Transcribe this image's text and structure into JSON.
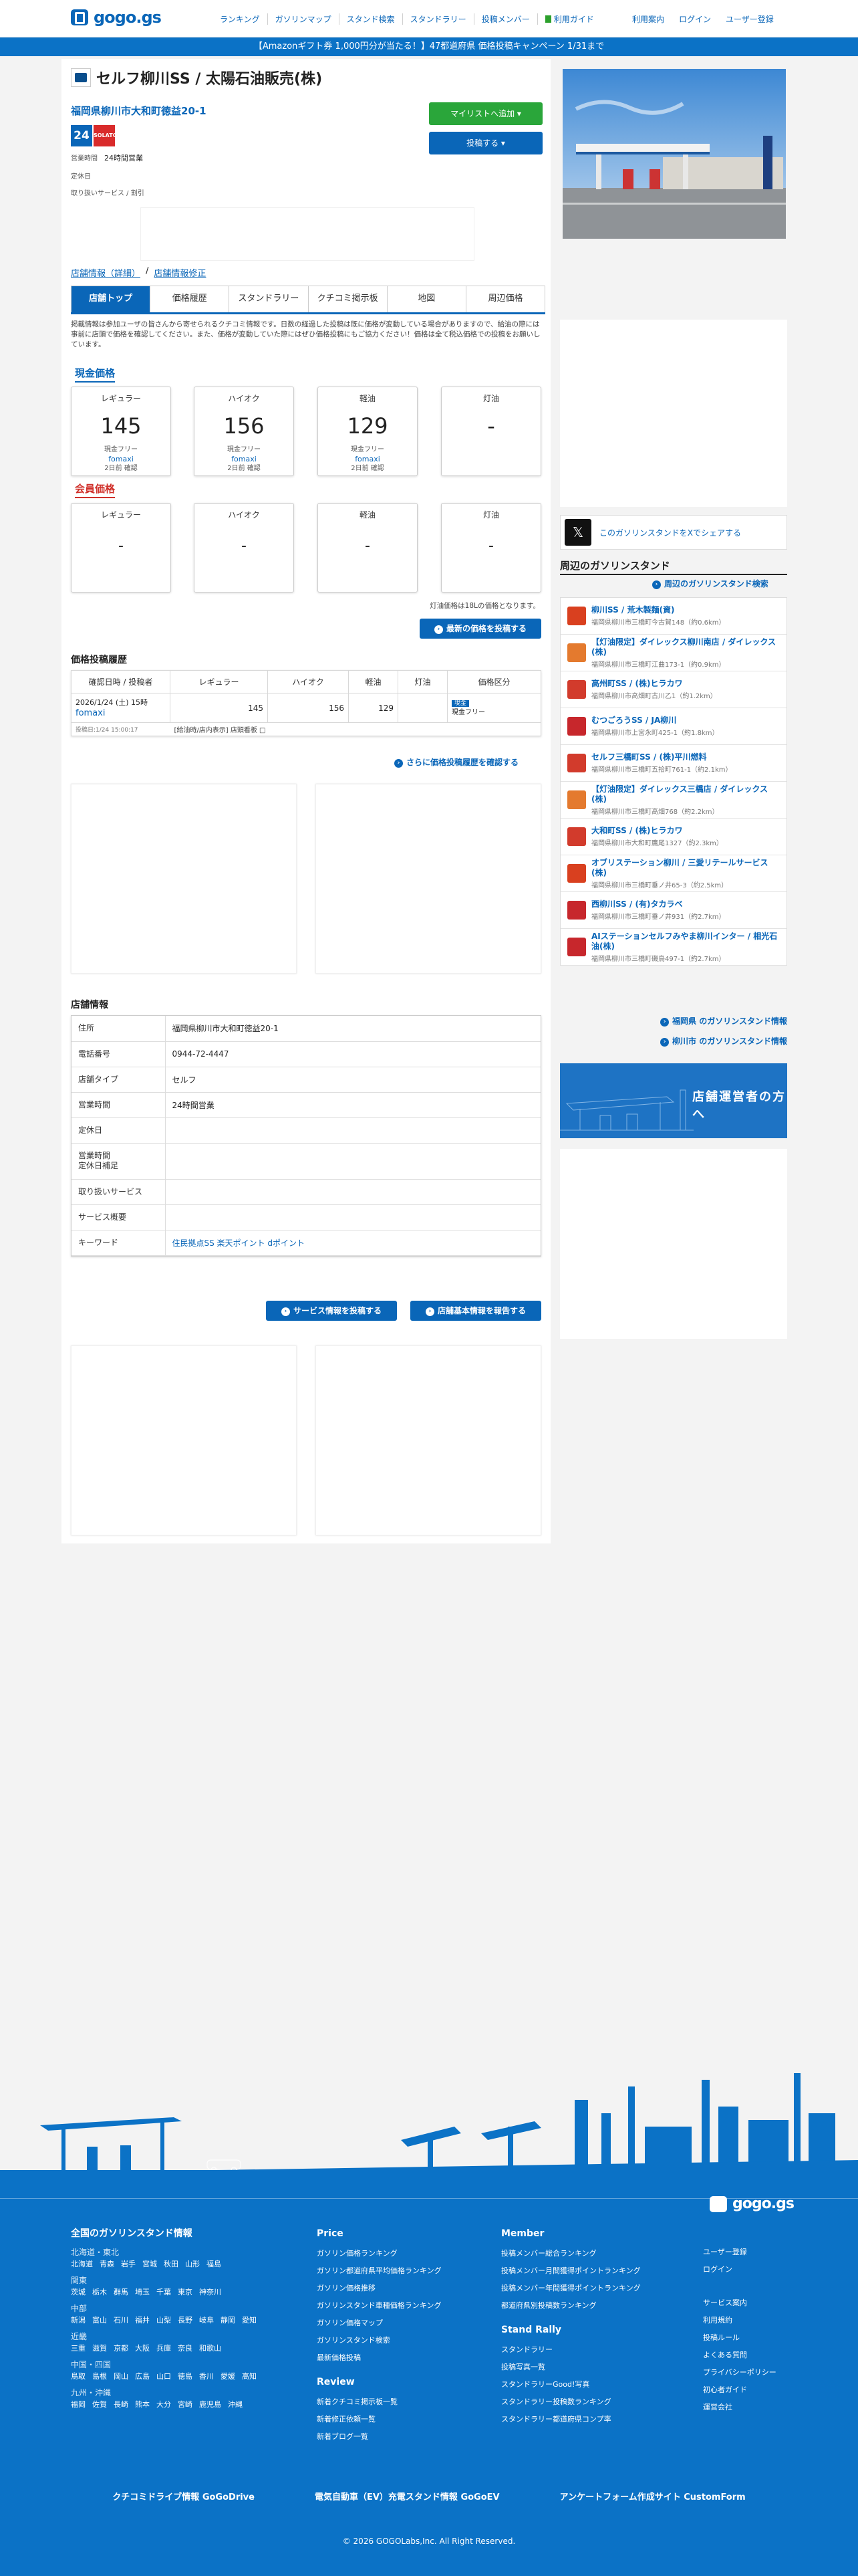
{
  "header": {
    "logo": "gogo.gs",
    "nav": [
      "ランキング",
      "ガソリンマップ",
      "スタンド検索",
      "スタンドラリー",
      "投稿メンバー",
      "利用ガイド"
    ],
    "right": [
      "利用案内",
      "ログイン",
      "ユーザー登録"
    ]
  },
  "banner": "【Amazonギフト券 1,000円分が当たる！】47都道府県 価格投稿キャンペーン 1/31まで",
  "station": {
    "name": "セルフ柳川SS / 太陽石油販売(株)",
    "address": "福岡県柳川市大和町徳益20-1",
    "badge24": "24",
    "brand": "SOLATO",
    "hours_label": "営業時間",
    "hours": "24時間営業",
    "closed_label": "定休日",
    "services_label": "取り扱いサービス / 割引",
    "mylist": "マイリストへ追加",
    "post": "投稿する"
  },
  "breadcrumb": [
    "店舗情報（詳細）",
    "店舗情報修正"
  ],
  "tabs": [
    "店舗トップ",
    "価格履歴",
    "スタンドラリー",
    "クチコミ掲示板",
    "地図",
    "周辺価格"
  ],
  "notice": "掲載情報は参加ユーザの皆さんから寄せられるクチコミ情報です。日数の経過した投稿は既に価格が変動している場合がありますので、給油の際には事前に店頭で価格を確認してください。また、価格が変動していた際にはぜひ価格投稿にもご協力ください！価格は全て税込価格での投稿をお願いしています。",
  "cash": {
    "title": "現金価格",
    "items": [
      {
        "label": "レギュラー",
        "value": "145",
        "kind": "現金フリー",
        "user": "fomaxi",
        "ago": "2日前 確認"
      },
      {
        "label": "ハイオク",
        "value": "156",
        "kind": "現金フリー",
        "user": "fomaxi",
        "ago": "2日前 確認"
      },
      {
        "label": "軽油",
        "value": "129",
        "kind": "現金フリー",
        "user": "fomaxi",
        "ago": "2日前 確認"
      },
      {
        "label": "灯油",
        "value": "-",
        "kind": "",
        "user": "",
        "ago": ""
      }
    ]
  },
  "member": {
    "title": "会員価格",
    "items": [
      {
        "label": "レギュラー",
        "value": "-"
      },
      {
        "label": "ハイオク",
        "value": "-"
      },
      {
        "label": "軽油",
        "value": "-"
      },
      {
        "label": "灯油",
        "value": "-"
      }
    ]
  },
  "kerosene_note": "灯油価格は18Lの価格となります。",
  "post_latest": "最新の価格を投稿する",
  "history": {
    "title": "価格投稿履歴",
    "headers": [
      "確認日時 / 投稿者",
      "レギュラー",
      "ハイオク",
      "軽油",
      "灯油",
      "価格区分"
    ],
    "row": {
      "date": "2026/1/24 (土) 15時",
      "user": "fomaxi",
      "regular": "145",
      "high": "156",
      "diesel": "129",
      "kerosene": "",
      "kind_badge": "現金",
      "kind": "現金フリー",
      "posted": "投稿日:1/24 15:00:17",
      "note": "[給油時/店内表示] 店頭看板 □"
    }
  },
  "more_history": "さらに価格投稿履歴を確認する",
  "info": {
    "title": "店舗情報",
    "rows": [
      {
        "k": "住所",
        "v": "福岡県柳川市大和町徳益20-1"
      },
      {
        "k": "電話番号",
        "v": "0944-72-4447"
      },
      {
        "k": "店舗タイプ",
        "v": "セルフ"
      },
      {
        "k": "営業時間",
        "v": "24時間営業"
      },
      {
        "k": "定休日",
        "v": ""
      },
      {
        "k": "営業時間\n定休日補足",
        "v": ""
      },
      {
        "k": "取り扱いサービス",
        "v": ""
      },
      {
        "k": "サービス概要",
        "v": ""
      },
      {
        "k": "キーワード",
        "v": "住民拠点SS 楽天ポイント dポイント"
      }
    ]
  },
  "btn_service": "サービス情報を投稿する",
  "btn_report": "店舗基本情報を報告する",
  "share_x": "このガソリンスタンドをXでシェアする",
  "nearby": {
    "title": "周辺のガソリンスタンド",
    "search": "周辺のガソリンスタンド検索",
    "items": [
      {
        "name": "柳川SS / 荒木製麺(資)",
        "addr": "福岡県柳川市三橋町今古賀148（約0.6km）",
        "c": "#d9401f"
      },
      {
        "name": "【灯油限定】ダイレックス柳川南店 / ダイレックス(株)",
        "addr": "福岡県柳川市三橋町江曲173-1（約0.9km）",
        "c": "#e47a2e"
      },
      {
        "name": "高州町SS / (株)ヒラカワ",
        "addr": "福岡県柳川市高畑町古川乙1（約1.2km）",
        "c": "#d23b2c"
      },
      {
        "name": "むつごろうSS / JA柳川",
        "addr": "福岡県柳川市上宮永町425-1（約1.8km）",
        "c": "#c7272c"
      },
      {
        "name": "セルフ三橋町SS / (株)平川燃料",
        "addr": "福岡県柳川市三橋町五拾町761-1（約2.1km）",
        "c": "#d23b2c"
      },
      {
        "name": "【灯油限定】ダイレックス三橋店 / ダイレックス(株)",
        "addr": "福岡県柳川市三橋町高畑768（約2.2km）",
        "c": "#e47a2e"
      },
      {
        "name": "大和町SS / (株)ヒラカワ",
        "addr": "福岡県柳川市大和町鷹尾1327（約2.3km）",
        "c": "#d23b2c"
      },
      {
        "name": "オブリステーション柳川 / 三愛リテールサービス(株)",
        "addr": "福岡県柳川市三橋町垂ノ井65-3（約2.5km）",
        "c": "#d9401f"
      },
      {
        "name": "西柳川SS / (有)タカラベ",
        "addr": "福岡県柳川市三橋町垂ノ井931（約2.7km）",
        "c": "#c7272c"
      },
      {
        "name": "AIステーションセルフみやま柳川インター / 相光石油(株)",
        "addr": "福岡県柳川市三橋町磯鳥497-1（約2.7km）",
        "c": "#c7272c"
      }
    ]
  },
  "side_links": [
    "福岡県 のガソリンスタンド情報",
    "柳川市 のガソリンスタンド情報"
  ],
  "operator": "店舗運営者の方へ",
  "footer": {
    "national": "全国のガソリンスタンド情報",
    "regions": [
      {
        "name": "北海道・東北",
        "prefs": [
          "北海道",
          "青森",
          "岩手",
          "宮城",
          "秋田",
          "山形",
          "福島"
        ]
      },
      {
        "name": "関東",
        "prefs": [
          "茨城",
          "栃木",
          "群馬",
          "埼玉",
          "千葉",
          "東京",
          "神奈川"
        ]
      },
      {
        "name": "中部",
        "prefs": [
          "新潟",
          "富山",
          "石川",
          "福井",
          "山梨",
          "長野",
          "岐阜",
          "静岡",
          "愛知"
        ]
      },
      {
        "name": "近畿",
        "prefs": [
          "三重",
          "滋賀",
          "京都",
          "大阪",
          "兵庫",
          "奈良",
          "和歌山"
        ]
      },
      {
        "name": "中国・四国",
        "prefs": [
          "鳥取",
          "島根",
          "岡山",
          "広島",
          "山口",
          "徳島",
          "香川",
          "愛媛",
          "高知"
        ]
      },
      {
        "name": "九州・沖縄",
        "prefs": [
          "福岡",
          "佐賀",
          "長崎",
          "熊本",
          "大分",
          "宮崎",
          "鹿児島",
          "沖縄"
        ]
      }
    ],
    "price_title": "Price",
    "price_links": [
      "ガソリン価格ランキング",
      "ガソリン都道府県平均価格ランキング",
      "ガソリン価格推移",
      "ガソリンスタンド車種価格ランキング",
      "ガソリン価格マップ",
      "ガソリンスタンド検索",
      "最新価格投稿"
    ],
    "review_title": "Review",
    "review_links": [
      "新着クチコミ掲示板一覧",
      "新着修正依頼一覧",
      "新着ブログ一覧"
    ],
    "member_title": "Member",
    "member_links": [
      "投稿メンバー総合ランキング",
      "投稿メンバー月間獲得ポイントランキング",
      "投稿メンバー年間獲得ポイントランキング",
      "都道府県別投稿数ランキング"
    ],
    "rally_title": "Stand Rally",
    "rally_links": [
      "スタンドラリー",
      "投稿写真一覧",
      "スタンドラリーGood!写真",
      "スタンドラリー投稿数ランキング",
      "スタンドラリー都道府県コンプ率"
    ],
    "right_links1": [
      "ユーザー登録",
      "ログイン"
    ],
    "right_links2": [
      "サービス案内",
      "利用規約",
      "投稿ルール",
      "よくある質問",
      "プライバシーポリシー",
      "初心者ガイド",
      "運営会社"
    ],
    "sister": [
      "クチコミドライブ情報 GoGoDrive",
      "電気自動車（EV）充電スタンド情報 GoGoEV",
      "アンケートフォーム作成サイト CustomForm"
    ],
    "copyright": "© 2026 GOGOLabs,Inc. All Right Reserved.",
    "logo": "gogo.gs"
  }
}
